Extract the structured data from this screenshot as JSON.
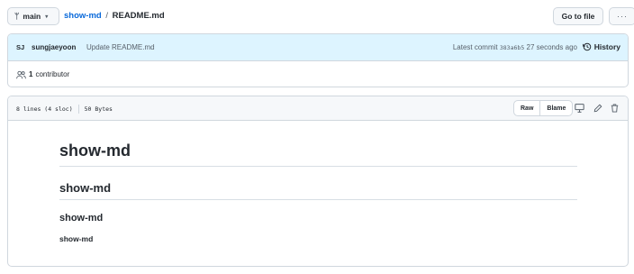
{
  "topbar": {
    "branch_label": "main",
    "branch_icon": "git-branch-icon",
    "repo_name": "show-md",
    "separator": "/",
    "file_name": "README.md",
    "goto_file_label": "Go to file",
    "more_label": "···"
  },
  "commit": {
    "avatar_initials": "SJ",
    "author": "sungjaeyoon",
    "message": "Update README.md",
    "latest_label": "Latest commit",
    "sha": "383a6b5",
    "time": "27 seconds ago",
    "history_label": "History",
    "contributor_count": "1",
    "contributor_label": "contributor"
  },
  "file": {
    "lines_info": "8 lines (4 sloc)",
    "size_info": "50 Bytes",
    "raw_label": "Raw",
    "blame_label": "Blame",
    "icons": [
      "desktop-icon",
      "pencil-icon",
      "trash-icon"
    ]
  },
  "readme": {
    "h1": "show-md",
    "h2": "show-md",
    "h3": "show-md",
    "h4": "show-md"
  },
  "colors": {
    "link": "#0969da",
    "commit_bg": "#ddf4ff",
    "header_bg": "#f6f8fa",
    "border": "#d0d7de"
  }
}
